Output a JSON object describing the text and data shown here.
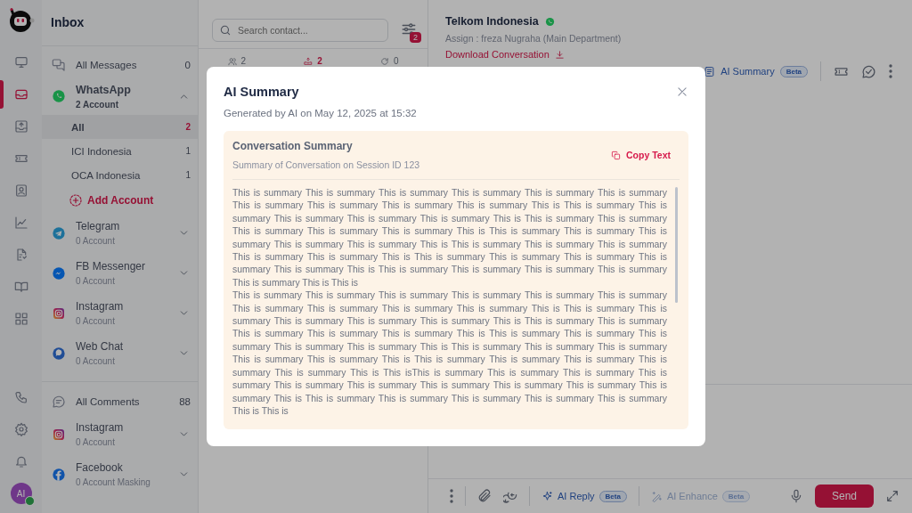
{
  "rail": {
    "items": [
      {
        "selected": false
      },
      {
        "selected": true
      },
      {
        "selected": false
      },
      {
        "selected": false
      },
      {
        "selected": false
      },
      {
        "selected": false
      },
      {
        "selected": false
      },
      {
        "selected": false
      },
      {
        "selected": false
      }
    ],
    "avatar": {
      "initials": "AI",
      "online": true
    }
  },
  "sidebar": {
    "title": "Inbox",
    "sections": [
      {
        "heading": {
          "label": "All Messages",
          "count": "0"
        },
        "channels": [
          {
            "name": "WhatsApp",
            "accounts": "2 Account",
            "expanded": true,
            "children": [
              {
                "label": "All",
                "count": "2",
                "selected": true
              },
              {
                "label": "ICI Indonesia",
                "count": "1",
                "selected": false
              },
              {
                "label": "OCA Indonesia",
                "count": "1",
                "selected": false
              }
            ],
            "add_label": "Add Account"
          },
          {
            "name": "Telegram",
            "accounts": "0 Account",
            "expanded": false
          },
          {
            "name": "FB Messenger",
            "accounts": "0 Account",
            "expanded": false
          },
          {
            "name": "Instagram",
            "accounts": "0 Account",
            "expanded": false
          },
          {
            "name": "Web Chat",
            "accounts": "0 Account",
            "expanded": false
          }
        ]
      },
      {
        "heading": {
          "label": "All Comments",
          "count": "88"
        },
        "channels": [
          {
            "name": "Instagram",
            "accounts": "0 Account",
            "expanded": false
          },
          {
            "name": "Facebook",
            "accounts": "0 Account Masking",
            "expanded": false
          }
        ]
      }
    ]
  },
  "contacts": {
    "search": {
      "placeholder": "Search contact..."
    },
    "filter_badge": "2",
    "tabs": [
      {
        "count": "2",
        "selected": false
      },
      {
        "count": "2",
        "selected": true
      },
      {
        "count": "0",
        "selected": false
      }
    ]
  },
  "chat": {
    "name": "Telkom Indonesia",
    "assign": "Assign : freza Nugraha (Main Department)",
    "download": "Download Conversation",
    "ai_summary": {
      "label": "AI Summary",
      "badge": "Beta"
    },
    "composer": {
      "ai_reply": {
        "label": "AI Reply",
        "badge": "Beta",
        "disabled": false
      },
      "ai_enhance": {
        "label": "AI Enhance",
        "badge": "Beta",
        "disabled": true
      },
      "send": "Send"
    }
  },
  "modal": {
    "title": "AI Summary",
    "subtitle": "Generated by AI on May 12, 2025 at 15:32",
    "card": {
      "title": "Conversation Summary",
      "subtitle": "Summary of Conversation on Session ID 123",
      "copy_label": "Copy Text",
      "paragraphs": [
        "This is summary This is summary This is summary This is summary This is summary This is summary This is summary This is summary This is summary This is summary This is This is summary This is summary This is summary This is summary This is summary This is This is summary This is summary This is summary This is summary This is summary This is This is summary This is summary This is summary This is summary This is summary This is This is summary This is summary This is summary This is summary This is summary This is This is summary This is summary This is summary This is summary This is summary This is This is summary This is summary This is summary This is summary This is summary This is This is",
        "This is summary This is summary This is summary This is summary This is summary This is summary This is summary This is summary This is summary This is summary This is This is summary This is summary This is summary This is summary This is summary This is This is summary This is summary This is summary This is summary This is summary This is This is summary This is summary This is summary This is summary This is summary This is This is summary This is summary This is summary This is summary This is summary This is This is summary This is summary This is summary This is summary This is summary This is This isThis is summary This is summary This is summary This is summary This is summary This is summary This is summary This is summary This is summary This is summary This is This is summary This is summary This is summary This is summary This is summary This is This is"
      ]
    }
  }
}
